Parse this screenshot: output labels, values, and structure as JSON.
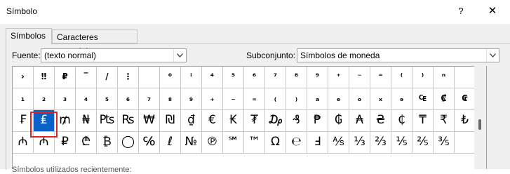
{
  "dialog": {
    "title": "Símbolo",
    "help_label": "?",
    "close_label": "✕"
  },
  "tabs": [
    {
      "label": "Símbolos",
      "active": true
    },
    {
      "label": "Caracteres especiales",
      "active": false
    }
  ],
  "font": {
    "label": "Fuente:",
    "value": "(texto normal)"
  },
  "subset": {
    "label": "Subconjunto:",
    "value": "Símbolos de moneda"
  },
  "symbols": [
    [
      "›",
      "‼",
      "₽",
      "‾",
      "/",
      "⋮",
      "",
      "⁰",
      "ⁱ",
      "⁴",
      "⁵",
      "⁶",
      "⁷",
      "⁸",
      "⁹",
      "⁺",
      "⁻",
      "⁼",
      "⁽",
      "⁾",
      "ⁿ",
      ""
    ],
    [
      "₁",
      "₂",
      "₃",
      "₄",
      "₅",
      "₆",
      "₇",
      "₈",
      "₉",
      "₊",
      "₋",
      "₌",
      "₍",
      "₎",
      "ₐ",
      "ₑ",
      "ₒ",
      "ₓ",
      "ₔ",
      "₠",
      "₡",
      "₢"
    ],
    [
      "₣",
      "₤",
      "₥",
      "₦",
      "₧",
      "₨",
      "₩",
      "₪",
      "₫",
      "€",
      "₭",
      "₮",
      "₯",
      "₰",
      "₱",
      "₲",
      "₳",
      "₴",
      "₵",
      "₸",
      "₹",
      "₺"
    ],
    [
      "₼",
      "₼",
      "₽",
      "₾",
      "₿",
      "◯",
      "℅",
      "ℓ",
      "№",
      "℗",
      "℠",
      "™",
      "Ω",
      "℮",
      "Ⅎ",
      "⅍",
      "⅓",
      "⅔",
      "⅕",
      "⅖",
      "⅗",
      ""
    ]
  ],
  "selected_symbol": "₤",
  "status_text": "Símbolos utilizados recientemente:",
  "colors": {
    "selection": "#0a62c9",
    "highlight_frame": "#e22222"
  }
}
